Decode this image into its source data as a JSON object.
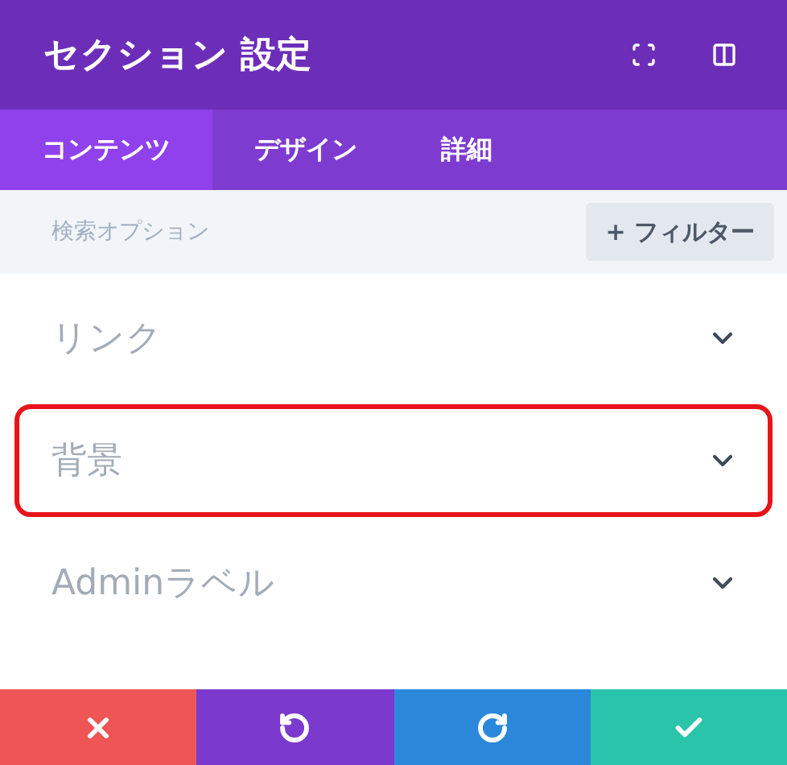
{
  "header": {
    "title": "セクション 設定"
  },
  "tabs": [
    {
      "label": "コンテンツ",
      "selected": true
    },
    {
      "label": "デザイン",
      "selected": false
    },
    {
      "label": "詳細",
      "selected": false
    }
  ],
  "search": {
    "placeholder": "検索オプション",
    "filter_button": "+ フィルター"
  },
  "sections": [
    {
      "label": "リンク",
      "expanded": false,
      "highlighted": false
    },
    {
      "label": "背景",
      "expanded": false,
      "highlighted": true
    },
    {
      "label": "Adminラベル",
      "expanded": false,
      "highlighted": false
    }
  ],
  "footer_buttons": [
    {
      "kind": "cancel"
    },
    {
      "kind": "undo"
    },
    {
      "kind": "redo"
    },
    {
      "kind": "save"
    }
  ]
}
